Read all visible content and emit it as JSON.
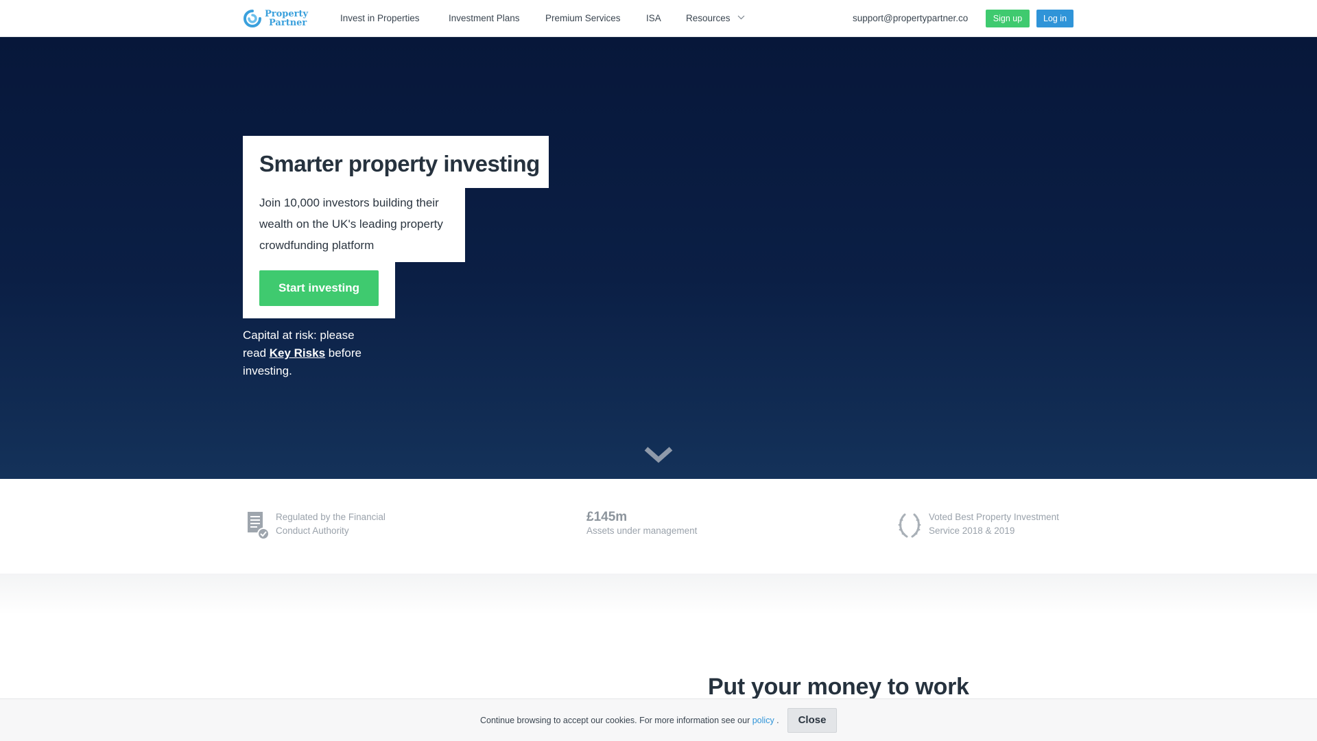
{
  "header": {
    "logo_line1": "Property",
    "logo_line2": "Partner",
    "nav": [
      "Invest in Properties",
      "Investment Plans",
      "Premium Services",
      "ISA",
      "Resources"
    ],
    "support_email": "support@propertypartner.co",
    "signup_label": "Sign up",
    "login_label": "Log in"
  },
  "hero": {
    "title": "Smarter property investing",
    "subtitle": "Join 10,000 investors building their wealth on the UK's leading property crowdfunding platform",
    "cta_label": "Start investing",
    "risk_prefix": "Capital at risk: please read ",
    "risk_link": "Key Risks",
    "risk_suffix": " before investing."
  },
  "stats": {
    "fca_text": "Regulated by the Financial Conduct Authority",
    "aum_value": "£145m",
    "aum_label": "Assets under management",
    "award_text": "Voted Best Property Investment Service 2018 & 2019"
  },
  "section": {
    "heading": "Put your money to work"
  },
  "cookie": {
    "text": "Continue browsing to accept our cookies. For more information see our ",
    "link": "policy",
    "suffix": " .",
    "close_label": "Close"
  },
  "colors": {
    "accent_green": "#3fca6f",
    "accent_blue": "#2f94d8",
    "hero_bg": "#07173a"
  },
  "icons": [
    "logo-swirl-icon",
    "chevron-down-icon",
    "document-check-icon",
    "laurel-wreath-icon",
    "scroll-down-chevron-icon"
  ]
}
